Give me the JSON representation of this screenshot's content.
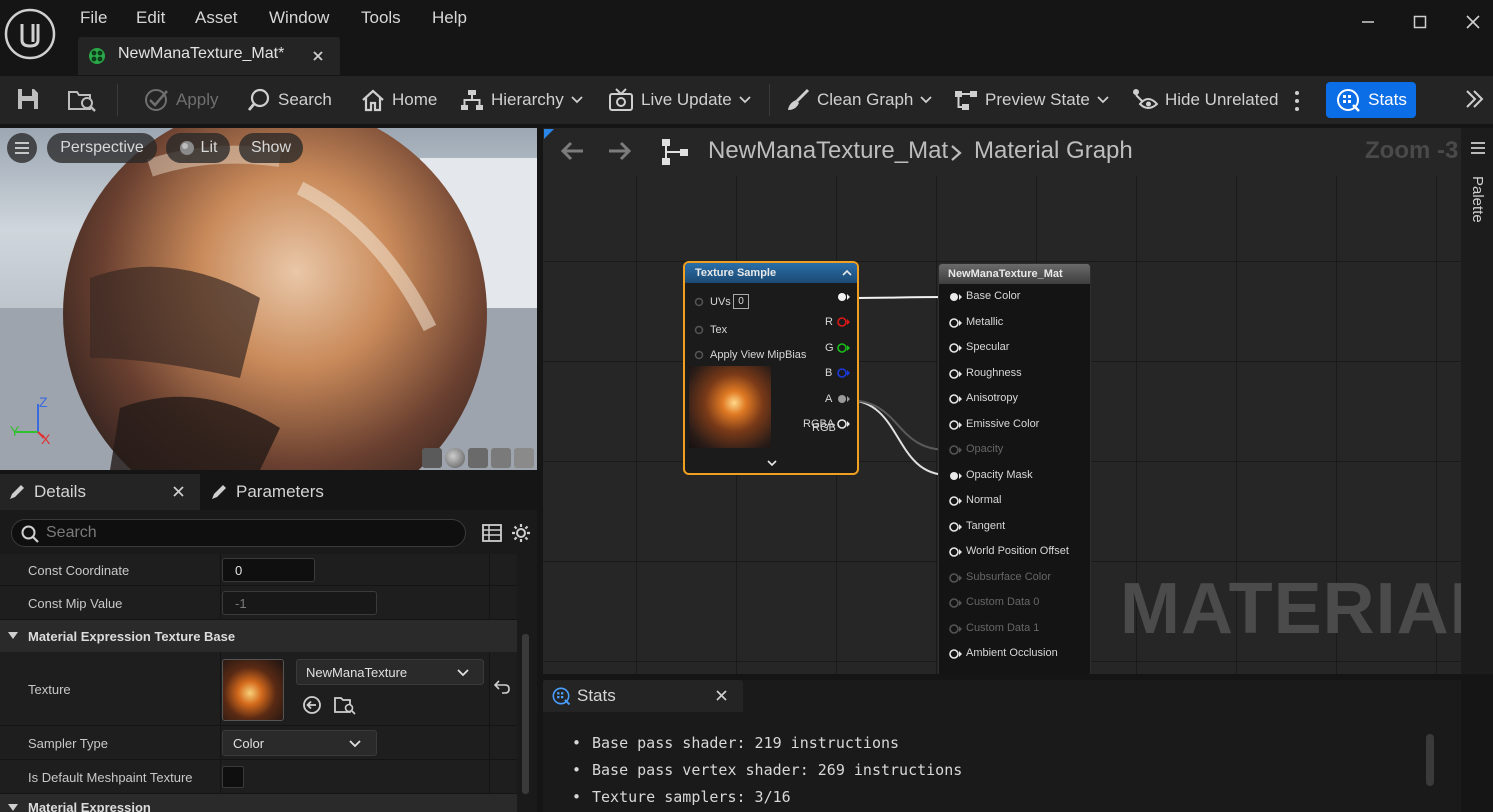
{
  "menu": {
    "items": [
      "File",
      "Edit",
      "Asset",
      "Window",
      "Tools",
      "Help"
    ]
  },
  "tab": {
    "title": "NewManaTexture_Mat*"
  },
  "toolbar": {
    "apply": "Apply",
    "search": "Search",
    "home": "Home",
    "hierarchy": "Hierarchy",
    "live_update": "Live Update",
    "clean_graph": "Clean Graph",
    "preview_state": "Preview State",
    "hide_unrelated": "Hide Unrelated",
    "stats": "Stats"
  },
  "viewport": {
    "perspective": "Perspective",
    "lit": "Lit",
    "show": "Show",
    "axis_z": "Z",
    "axis_y": "Y",
    "axis_x": "X"
  },
  "details": {
    "tab_details": "Details",
    "tab_parameters": "Parameters",
    "search_placeholder": "Search",
    "const_coordinate_label": "Const Coordinate",
    "const_coordinate_value": "0",
    "const_mip_label": "Const Mip Value",
    "const_mip_value": "-1",
    "category_texture_base": "Material Expression Texture Base",
    "texture_label": "Texture",
    "texture_value": "NewManaTexture",
    "sampler_label": "Sampler Type",
    "sampler_value": "Color",
    "meshpaint_label": "Is Default Meshpaint Texture",
    "category_expression": "Material Expression"
  },
  "graph": {
    "breadcrumb_asset": "NewManaTexture_Mat",
    "breadcrumb_graph": "Material Graph",
    "zoom": "Zoom -3",
    "watermark": "MATERIAL",
    "texture_node": {
      "title": "Texture Sample",
      "inputs": [
        "UVs",
        "Tex",
        "Apply View MipBias"
      ],
      "uv_value": "0",
      "outputs": [
        "RGB",
        "R",
        "G",
        "B",
        "A",
        "RGBA"
      ]
    },
    "material_node": {
      "title": "NewManaTexture_Mat",
      "inputs": [
        "Base Color",
        "Metallic",
        "Specular",
        "Roughness",
        "Anisotropy",
        "Emissive Color",
        "Opacity",
        "Opacity Mask",
        "Normal",
        "Tangent",
        "World Position Offset",
        "Subsurface Color",
        "Custom Data 0",
        "Custom Data 1",
        "Ambient Occlusion"
      ]
    }
  },
  "palette": {
    "label": "Palette"
  },
  "stats": {
    "tab": "Stats",
    "lines": [
      "Base pass shader: 219 instructions",
      "Base pass vertex shader: 269 instructions",
      "Texture samplers: 3/16"
    ]
  },
  "colors": {
    "accent": "#0b6ee6",
    "node_selected": "#f0a020",
    "pin_r": "#e01818",
    "pin_g": "#18c018",
    "pin_b": "#1a3ae0"
  }
}
